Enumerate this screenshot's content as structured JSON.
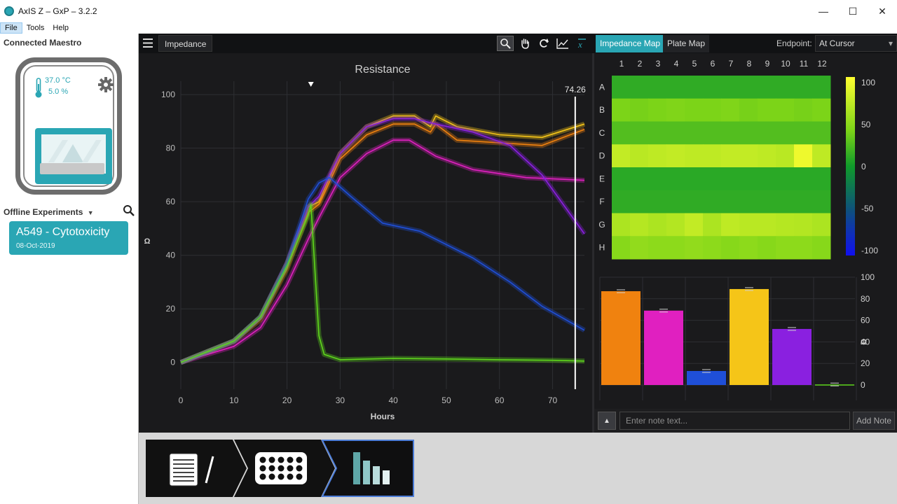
{
  "window": {
    "title": "AxIS Z – GxP – 3.2.2",
    "controls": [
      "—",
      "☐",
      "✕"
    ]
  },
  "menu": [
    "File",
    "Tools",
    "Help"
  ],
  "sidebar": {
    "connected_label": "Connected Maestro",
    "temperature": "37.0 °C",
    "co2": "5.0 %",
    "offline_label": "Offline Experiments",
    "experiment": {
      "name": "A549 - Cytotoxicity",
      "date": "08-Oct-2019"
    }
  },
  "toolbar": {
    "view_tab": "Impedance",
    "tab_map": "Impedance Map",
    "tab_plate": "Plate Map",
    "endpoint_label": "Endpoint:",
    "endpoint_value": "At Cursor"
  },
  "notes": {
    "placeholder": "Enter note text...",
    "add_label": "Add Note"
  },
  "chart_data": [
    {
      "type": "line",
      "title": "Resistance",
      "xlabel": "Hours",
      "ylabel": "Ω",
      "xlim": [
        0,
        76
      ],
      "ylim": [
        -10,
        105
      ],
      "xticks": [
        0,
        10,
        20,
        30,
        40,
        50,
        60,
        70
      ],
      "yticks": [
        0,
        20,
        40,
        60,
        80,
        100
      ],
      "cursor": {
        "x": 74.26,
        "label": "74.26"
      },
      "marker_x": 24.5,
      "grid": true,
      "series": [
        {
          "color": "#f5c518",
          "x": [
            0,
            5,
            10,
            15,
            20,
            24,
            26,
            30,
            35,
            40,
            44,
            47,
            48,
            52,
            60,
            68,
            76
          ],
          "y": [
            0,
            4,
            8,
            17,
            37,
            58,
            60,
            78,
            88,
            92,
            92,
            88,
            92,
            88,
            85,
            84,
            89
          ]
        },
        {
          "color": "#f0820f",
          "x": [
            0,
            5,
            10,
            15,
            20,
            24,
            26,
            30,
            35,
            40,
            44,
            47,
            48,
            52,
            60,
            68,
            76
          ],
          "y": [
            0,
            4,
            8,
            16,
            35,
            56,
            59,
            76,
            85,
            89,
            89,
            86,
            89,
            83,
            82,
            81,
            87
          ]
        },
        {
          "color": "#e020c0",
          "x": [
            0,
            5,
            10,
            15,
            20,
            24,
            26,
            30,
            35,
            40,
            43,
            48,
            55,
            65,
            76
          ],
          "y": [
            0,
            3,
            6,
            13,
            29,
            46,
            54,
            69,
            78,
            83,
            83,
            77,
            72,
            69,
            68
          ]
        },
        {
          "color": "#8a20e0",
          "x": [
            0,
            5,
            10,
            15,
            20,
            24,
            26,
            30,
            35,
            40,
            44,
            48,
            55,
            62,
            68,
            76
          ],
          "y": [
            0,
            4,
            8,
            17,
            37,
            58,
            62,
            78,
            88,
            91,
            91,
            89,
            86,
            81,
            70,
            48
          ]
        },
        {
          "color": "#1f4fd8",
          "x": [
            0,
            5,
            10,
            15,
            20,
            24,
            26,
            28,
            32,
            38,
            45,
            48,
            55,
            62,
            68,
            76
          ],
          "y": [
            0,
            4,
            8,
            17,
            37,
            61,
            67,
            69,
            62,
            52,
            49,
            46,
            39,
            30,
            21,
            12
          ]
        },
        {
          "color": "#5fd61c",
          "x": [
            0,
            5,
            10,
            15,
            20,
            24,
            24.5,
            26,
            27,
            30,
            40,
            50,
            60,
            70,
            76
          ],
          "y": [
            0,
            4,
            8,
            17,
            36,
            55,
            59,
            10,
            3,
            1,
            1.5,
            1.3,
            1,
            0.8,
            0.5
          ]
        }
      ]
    },
    {
      "type": "heatmap",
      "title": "Impedance Map",
      "columns": [
        "1",
        "2",
        "3",
        "4",
        "5",
        "6",
        "7",
        "8",
        "9",
        "10",
        "11",
        "12"
      ],
      "rows": [
        "A",
        "B",
        "C",
        "D",
        "E",
        "F",
        "G",
        "H"
      ],
      "colorbar_ticks": [
        100,
        50,
        0,
        -50,
        -100
      ],
      "values": [
        [
          12,
          12,
          12,
          12,
          12,
          12,
          12,
          12,
          12,
          12,
          12,
          12
        ],
        [
          40,
          38,
          40,
          42,
          40,
          40,
          42,
          38,
          40,
          40,
          38,
          40
        ],
        [
          25,
          25,
          25,
          25,
          25,
          25,
          25,
          25,
          25,
          25,
          25,
          25
        ],
        [
          72,
          68,
          70,
          72,
          70,
          70,
          72,
          72,
          70,
          68,
          92,
          70
        ],
        [
          10,
          10,
          10,
          10,
          10,
          10,
          10,
          10,
          10,
          10,
          10,
          10
        ],
        [
          12,
          12,
          12,
          12,
          12,
          12,
          12,
          12,
          12,
          12,
          12,
          12
        ],
        [
          62,
          66,
          62,
          65,
          72,
          62,
          70,
          68,
          68,
          66,
          65,
          62
        ],
        [
          45,
          50,
          48,
          48,
          50,
          48,
          45,
          48,
          45,
          48,
          48,
          45
        ]
      ]
    },
    {
      "type": "bar",
      "ylabel": "Ω",
      "ylim": [
        0,
        100
      ],
      "yticks": [
        0,
        20,
        40,
        60,
        80,
        100
      ],
      "series": [
        {
          "color": "#f0820f",
          "values": [
            87
          ]
        },
        {
          "color": "#e020c0",
          "values": [
            69
          ]
        },
        {
          "color": "#1f4fd8",
          "values": [
            13
          ]
        },
        {
          "color": "#f5c518",
          "values": [
            89
          ]
        },
        {
          "color": "#8a20e0",
          "values": [
            52
          ]
        },
        {
          "color": "#5fd61c",
          "values": [
            0.5
          ]
        }
      ]
    }
  ]
}
